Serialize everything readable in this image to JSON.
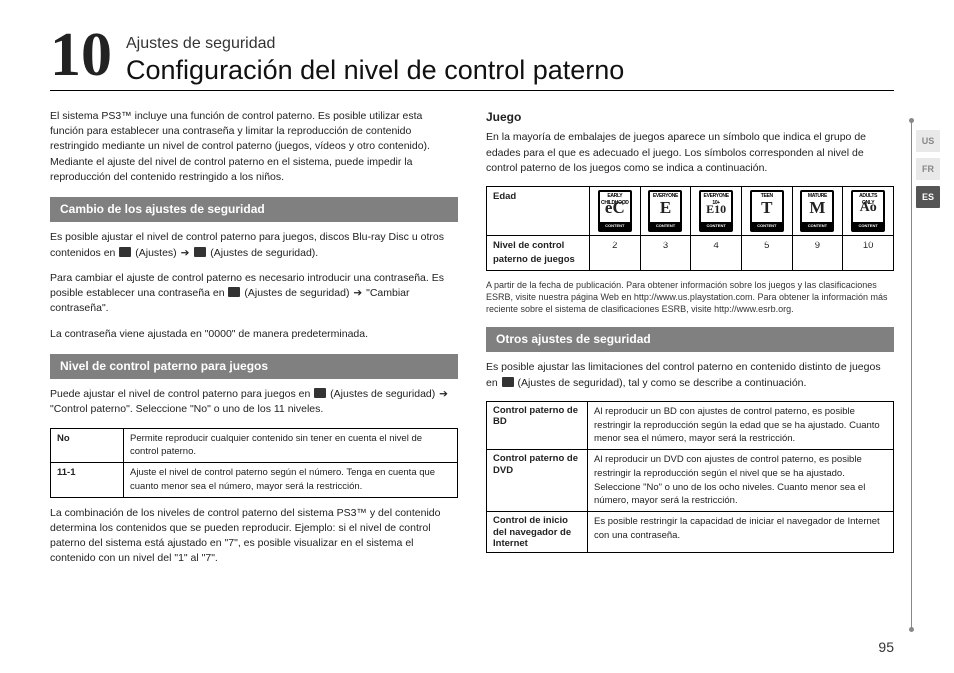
{
  "header": {
    "number": "10",
    "kicker": "Ajustes de seguridad",
    "title": "Configuración del nivel de control paterno"
  },
  "langs": {
    "us": "US",
    "fr": "FR",
    "es": "ES"
  },
  "page_number": "95",
  "left": {
    "intro": "El sistema PS3™ incluye una función de control paterno. Es posible utilizar esta función para establecer una contraseña y limitar la reproducción de contenido restringido mediante un nivel de control paterno (juegos, vídeos y otro contenido). Mediante el ajuste del nivel de control paterno en el sistema, puede impedir la reproducción del contenido restringido a los niños.",
    "sect1_title": "Cambio de los ajustes de seguridad",
    "sect1_p1a": "Es posible ajustar el nivel de control paterno para juegos, discos Blu-ray Disc u otros contenidos en ",
    "sect1_p1b": " (Ajustes) ",
    "sect1_p1c": " (Ajustes de seguridad).",
    "sect1_p2a": "Para cambiar el ajuste de control paterno es necesario introducir una contraseña. Es posible establecer una contraseña en ",
    "sect1_p2b": " (Ajustes de seguridad) ",
    "sect1_p2c": " \"Cambiar contraseña\".",
    "sect1_p3": "La contraseña viene ajustada en \"0000\" de manera predeterminada.",
    "sect2_title": "Nivel de control paterno para juegos",
    "sect2_p1a": "Puede ajustar el nivel de control paterno para juegos en ",
    "sect2_p1b": " (Ajustes de seguridad) ",
    "sect2_p1c": " \"Control paterno\". Seleccione \"No\" o uno de los 11 niveles.",
    "levels": [
      {
        "k": "No",
        "v": "Permite reproducir cualquier contenido sin tener en cuenta el nivel de control paterno."
      },
      {
        "k": "11-1",
        "v": "Ajuste el nivel de control paterno según el número. Tenga en cuenta que cuanto menor sea el número, mayor será la restricción."
      }
    ],
    "sect2_p2": "La combinación de los niveles de control paterno del sistema PS3™ y del contenido determina los contenidos que se pueden reproducir. Ejemplo: si el nivel de control paterno del sistema está ajustado en \"7\", es posible visualizar en el sistema el contenido con un nivel del \"1\" al \"7\"."
  },
  "right": {
    "juego_title": "Juego",
    "juego_p": "En la mayoría de embalajes de juegos aparece un símbolo que indica el grupo de edades para el que es adecuado el juego. Los símbolos corresponden al nivel de control paterno de los juegos como se indica a continuación.",
    "ratings_row1_label": "Edad",
    "ratings_row2_label": "Nivel de control paterno de juegos",
    "rating_cells": [
      {
        "top": "EARLY CHILDHOOD",
        "big": "eC",
        "val": "2"
      },
      {
        "top": "EVERYONE",
        "big": "E",
        "val": "3"
      },
      {
        "top": "EVERYONE 10+",
        "big": "E10",
        "val": "4"
      },
      {
        "top": "TEEN",
        "big": "T",
        "val": "5"
      },
      {
        "top": "MATURE",
        "big": "M",
        "val": "9"
      },
      {
        "top": "ADULTS ONLY",
        "big": "Ao",
        "val": "10"
      }
    ],
    "ratings_note": "A partir de la fecha de publicación. Para obtener información sobre los juegos y las clasificaciones ESRB, visite nuestra página Web en http://www.us.playstation.com. Para obtener la información más reciente sobre el sistema de clasificaciones ESRB, visite http://www.esrb.org.",
    "sect3_title": "Otros ajustes de seguridad",
    "sect3_p_a": "Es posible ajustar las limitaciones del control paterno en contenido distinto de juegos en ",
    "sect3_p_b": " (Ajustes de seguridad), tal y como se describe a continuación.",
    "other": [
      {
        "k": "Control paterno de BD",
        "v": "Al reproducir un BD con ajustes de control paterno, es posible restringir la reproducción según la edad que se ha ajustado. Cuanto menor sea el número, mayor será la restricción."
      },
      {
        "k": "Control paterno de DVD",
        "v": "Al reproducir un DVD con ajustes de control paterno, es posible restringir la reproducción según el nivel que se ha ajustado. Seleccione \"No\" o uno de los ocho niveles. Cuanto menor sea el número, mayor será la restricción."
      },
      {
        "k": "Control de inicio del navegador de Internet",
        "v": "Es posible restringir la capacidad de iniciar el navegador de Internet con una contraseña."
      }
    ]
  }
}
